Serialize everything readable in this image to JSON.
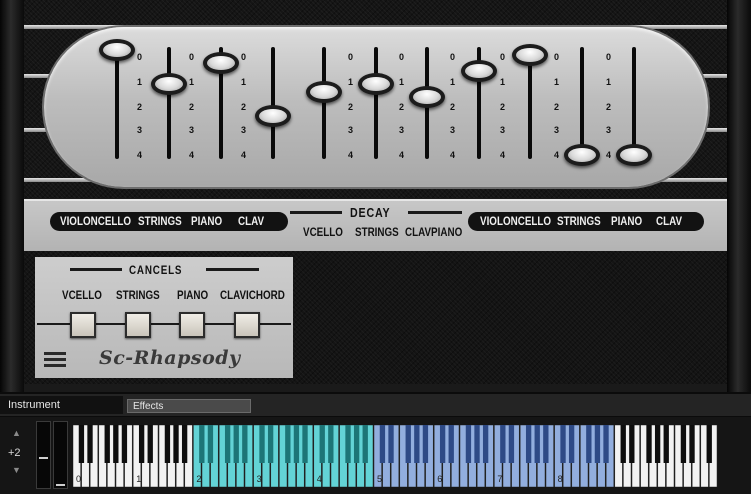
{
  "sliders": {
    "left_group": [
      {
        "name": "violoncello",
        "level": 0
      },
      {
        "name": "strings",
        "level": 1.3
      },
      {
        "name": "piano",
        "level": 0.5
      },
      {
        "name": "clav",
        "level": 2.5
      }
    ],
    "decay_group": [
      {
        "name": "vcello",
        "level": 1.6
      },
      {
        "name": "strings",
        "level": 1.3
      },
      {
        "name": "clav_piano",
        "level": 1.8
      }
    ],
    "right_group": [
      {
        "name": "violoncello",
        "level": 0.8
      },
      {
        "name": "strings",
        "level": 0.2
      },
      {
        "name": "piano",
        "level": 4
      },
      {
        "name": "clav",
        "level": 4
      }
    ],
    "tick_labels": [
      "0",
      "1",
      "2",
      "3",
      "4"
    ]
  },
  "labels": {
    "left": [
      "VIOLONCELLO",
      "STRINGS",
      "PIANO",
      "CLAV"
    ],
    "decay_title": "DECAY",
    "decay": [
      "VCELLO",
      "STRINGS",
      "CLAVPIANO"
    ],
    "right": [
      "VIOLONCELLO",
      "STRINGS",
      "PIANO",
      "CLAV"
    ]
  },
  "cancels": {
    "title": "CANCELS",
    "buttons": [
      "VCELLO",
      "STRINGS",
      "PIANO",
      "CLAVICHORD"
    ]
  },
  "brand": "Sc-Rhapsody",
  "tabs": {
    "instrument": "Instrument",
    "effects": "Effects"
  },
  "keyboard": {
    "octave_shift": "+2",
    "octave_labels": [
      "0",
      "1",
      "2",
      "3",
      "4",
      "5",
      "6",
      "7",
      "8"
    ],
    "ranges": {
      "cyan": {
        "color": "#63d3d6",
        "from_white_key": 14,
        "to_white_key": 34
      },
      "blue": {
        "color": "#92aede",
        "from_white_key": 35,
        "to_white_key": 62
      }
    }
  },
  "colors": {
    "panel_silver": "#c0c0c0",
    "dark": "#121212"
  }
}
